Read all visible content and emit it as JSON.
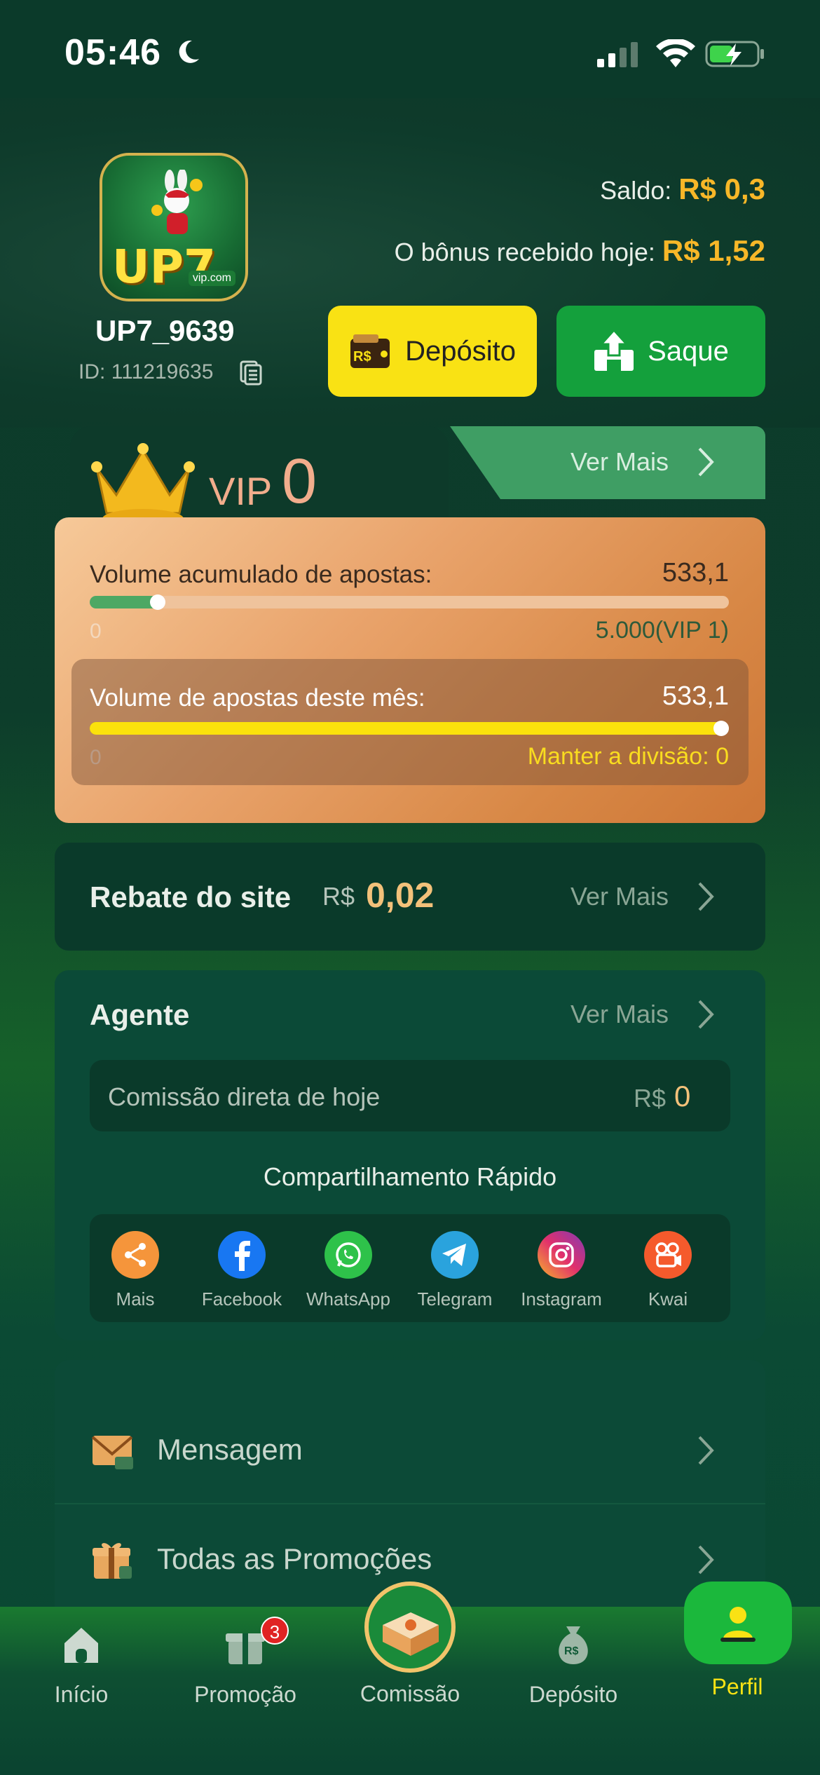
{
  "status_bar": {
    "time": "05:46"
  },
  "profile": {
    "username": "UP7_9639",
    "id_label": "ID:",
    "id_value": "111219635",
    "avatar_brand": "UP7",
    "avatar_site": "vip.com"
  },
  "balance": {
    "saldo_label": "Saldo:",
    "saldo_value": "R$ 0,3",
    "bonus_label": "O bônus recebido hoje:",
    "bonus_value": "R$ 1,52"
  },
  "actions": {
    "deposit_label": "Depósito",
    "deposit_icon_text": "R$",
    "withdraw_label": "Saque"
  },
  "vip": {
    "label": "VIP",
    "level": "0",
    "more_label": "Ver Mais",
    "total_label": "Volume acumulado de apostas:",
    "total_value": "533,1",
    "total_min": "0",
    "total_target": "5.000(VIP 1)",
    "total_progress": 0.1066,
    "month_label": "Volume de apostas deste mês:",
    "month_value": "533,1",
    "month_min": "0",
    "month_keep": "Manter a divisão: 0",
    "month_progress": 1.0
  },
  "rebate": {
    "title": "Rebate do site",
    "currency": "R$",
    "value": "0,02",
    "more_label": "Ver Mais"
  },
  "agent": {
    "title": "Agente",
    "more_label": "Ver Mais",
    "commission_label": "Comissão direta de hoje",
    "commission_currency": "R$",
    "commission_value": "0",
    "share_title": "Compartilhamento Rápido",
    "share_items": [
      {
        "label": "Mais",
        "icon": "share-icon",
        "color": "#f5953b"
      },
      {
        "label": "Facebook",
        "icon": "facebook-icon",
        "color": "#1877f2"
      },
      {
        "label": "WhatsApp",
        "icon": "whatsapp-icon",
        "color": "#2ec24a"
      },
      {
        "label": "Telegram",
        "icon": "telegram-icon",
        "color": "#2aa3dd"
      },
      {
        "label": "Instagram",
        "icon": "instagram-icon",
        "color": "#d2307e"
      },
      {
        "label": "Kwai",
        "icon": "kwai-icon",
        "color": "#f55a2c"
      }
    ]
  },
  "menu": {
    "items": [
      {
        "label": "Mensagem",
        "icon": "envelope-icon"
      },
      {
        "label": "Todas as Promoções",
        "icon": "gift-icon"
      }
    ]
  },
  "bottom_nav": {
    "items": [
      {
        "label": "Início",
        "icon": "home-icon"
      },
      {
        "label": "Promoção",
        "icon": "gift-icon",
        "badge": "3"
      },
      {
        "label": "Comissão",
        "icon": "money-box-icon"
      },
      {
        "label": "Depósito",
        "icon": "money-bag-icon"
      },
      {
        "label": "Perfil",
        "icon": "user-icon"
      }
    ]
  },
  "colors": {
    "accent_gold": "#f7b728",
    "deposit_yellow": "#f9e214",
    "saque_green": "#14a03c",
    "vip_progress_green": "#4da864",
    "month_progress_yellow": "#fbe20c"
  }
}
